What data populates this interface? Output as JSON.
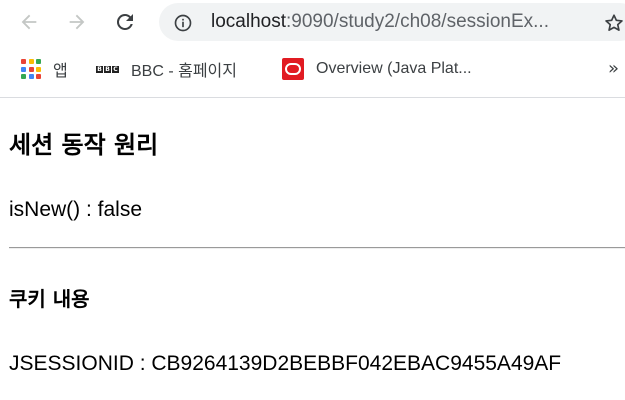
{
  "browser": {
    "url_host": "localhost",
    "url_path": ":9090/study2/ch08/sessionEx...",
    "back_icon": "arrow-left-icon",
    "forward_icon": "arrow-right-icon",
    "reload_icon": "reload-icon",
    "info_icon": "info-circle-icon",
    "star_icon": "star-outline-icon"
  },
  "bookmarks": {
    "items": [
      {
        "label": "앱",
        "icon": "apps-grid-icon"
      },
      {
        "label": "BBC - 홈페이지",
        "icon": "bbc-logo-icon",
        "logo_text": [
          "B",
          "B",
          "C"
        ]
      },
      {
        "label": "Overview (Java Plat...",
        "icon": "oracle-icon"
      }
    ],
    "more_label": "»"
  },
  "page": {
    "title": "세션 동작 원리",
    "is_new_line": "isNew() : false",
    "cookie_heading": "쿠키 내용",
    "cookie_line": "JSESSIONID : CB9264139D2BEBBF042EBAC9455A49AF"
  },
  "colors": {
    "omnibox_bg": "#f1f3f4",
    "oracle_red": "#e11b22",
    "text": "#000000",
    "chrome_icon": "#5f6368"
  }
}
